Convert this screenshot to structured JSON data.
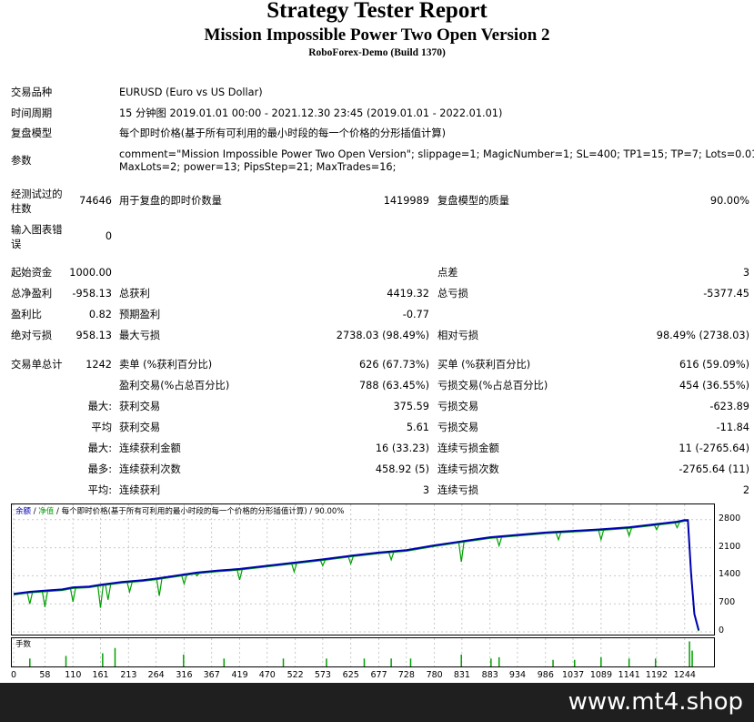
{
  "header": {
    "title": "Strategy Tester Report",
    "subtitle": "Mission Impossible Power Two Open Version 2",
    "server": "RoboForex-Demo (Build 1370)"
  },
  "info": {
    "symbol_label": "交易品种",
    "symbol_value": "EURUSD (Euro vs US Dollar)",
    "period_label": "时间周期",
    "period_value": "15 分钟图 2019.01.01 00:00 - 2021.12.30 23:45 (2019.01.01 - 2022.01.01)",
    "model_label": "复盘模型",
    "model_value": "每个即时价格(基于所有可利用的最小时段的每一个价格的分形插值计算)",
    "params_label": "参数",
    "params_line1": "comment=\"Mission Impossible Power Two Open Version\"; slippage=1; MagicNumber=1; SL=400; TP1=15; TP=7; Lots=0.01;",
    "params_line2": "MaxLots=2; power=13; PipsStep=21; MaxTrades=16;"
  },
  "bars": {
    "label_line1": "经测试过的",
    "label_line2": "柱数",
    "value": "74646",
    "ticks_label": "用于复盘的即时价数量",
    "ticks_value": "1419989",
    "quality_label": "复盘模型的质量",
    "quality_value": "90.00%",
    "errors_line1": "输入图表错",
    "errors_line2": "误",
    "errors_value": "0"
  },
  "stats": {
    "deposit_label": "起始资金",
    "deposit_value": "1000.00",
    "spread_label": "点差",
    "spread_value": "3",
    "net_label": "总净盈利",
    "net_value": "-958.13",
    "gross_profit_label": "总获利",
    "gross_profit_value": "4419.32",
    "gross_loss_label": "总亏损",
    "gross_loss_value": "-5377.45",
    "pf_label": "盈利比",
    "pf_value": "0.82",
    "payoff_label": "预期盈利",
    "payoff_value": "-0.77",
    "abs_dd_label": "绝对亏损",
    "abs_dd_value": "958.13",
    "max_dd_label": "最大亏损",
    "max_dd_value": "2738.03 (98.49%)",
    "rel_dd_label": "相对亏损",
    "rel_dd_value": "98.49% (2738.03)",
    "trades_label": "交易单总计",
    "trades_value": "1242",
    "short_label": "卖单 (%获利百分比)",
    "short_value": "626 (67.73%)",
    "long_label": "买单 (%获利百分比)",
    "long_value": "616 (59.09%)",
    "win_label": "盈利交易(%占总百分比)",
    "win_value": "788 (63.45%)",
    "loss_label": "亏损交易(%占总百分比)",
    "loss_value": "454 (36.55%)",
    "largest_prefix": "最大:",
    "largest_win_label": "获利交易",
    "largest_win_value": "375.59",
    "largest_loss_label": "亏损交易",
    "largest_loss_value": "-623.89",
    "average_prefix": "平均",
    "avg_win_label": "获利交易",
    "avg_win_value": "5.61",
    "avg_loss_label": "亏损交易",
    "avg_loss_value": "-11.84",
    "max_prefix": "最大:",
    "max_consec_win_label": "连续获利金额",
    "max_consec_win_value": "16 (33.23)",
    "max_consec_loss_label": "连续亏损金额",
    "max_consec_loss_value": "11 (-2765.64)",
    "maximal_prefix": "最多:",
    "maximal_consec_win_label": "连续获利次数",
    "maximal_consec_win_value": "458.92 (5)",
    "maximal_consec_loss_label": "连续亏损次数",
    "maximal_consec_loss_value": "-2765.64 (11)",
    "avg_consec_prefix": "平均:",
    "avg_consec_win_label": "连续获利",
    "avg_consec_win_value": "3",
    "avg_consec_loss_label": "连续亏损",
    "avg_consec_loss_value": "2"
  },
  "chart_data": {
    "type": "line",
    "legend_balance": "余额",
    "legend_equity": "净值",
    "legend_sep": "/",
    "legend_rest": "每个即时价格(基于所有可利用的最小时段的每一个价格的分形插值计算) / 90.00%",
    "volume_label": "手数",
    "colors": {
      "balance": "#0000b4",
      "equity": "#00a000",
      "grid": "#c8c8c8"
    },
    "ylim": [
      0,
      3000
    ],
    "y_ticks": [
      "2800",
      "2100",
      "1400",
      "700",
      "0"
    ],
    "x_ticks": [
      "0",
      "58",
      "110",
      "161",
      "213",
      "264",
      "316",
      "367",
      "419",
      "470",
      "522",
      "573",
      "625",
      "677",
      "728",
      "780",
      "831",
      "883",
      "934",
      "986",
      "1037",
      "1089",
      "1141",
      "1192",
      "1244"
    ],
    "xlim": [
      0,
      1295
    ],
    "balance": [
      [
        0,
        950
      ],
      [
        30,
        1000
      ],
      [
        60,
        1030
      ],
      [
        90,
        1060
      ],
      [
        110,
        1110
      ],
      [
        140,
        1130
      ],
      [
        161,
        1175
      ],
      [
        200,
        1245
      ],
      [
        240,
        1290
      ],
      [
        264,
        1330
      ],
      [
        300,
        1400
      ],
      [
        340,
        1480
      ],
      [
        380,
        1530
      ],
      [
        419,
        1570
      ],
      [
        470,
        1650
      ],
      [
        522,
        1730
      ],
      [
        573,
        1810
      ],
      [
        625,
        1900
      ],
      [
        677,
        1980
      ],
      [
        728,
        2040
      ],
      [
        780,
        2160
      ],
      [
        831,
        2260
      ],
      [
        883,
        2360
      ],
      [
        934,
        2420
      ],
      [
        986,
        2480
      ],
      [
        1037,
        2520
      ],
      [
        1089,
        2560
      ],
      [
        1141,
        2610
      ],
      [
        1192,
        2690
      ],
      [
        1230,
        2750
      ],
      [
        1244,
        2790
      ],
      [
        1250,
        2790
      ],
      [
        1256,
        1450
      ],
      [
        1262,
        450
      ],
      [
        1270,
        40
      ]
    ],
    "equity_dips": [
      [
        30,
        700
      ],
      [
        58,
        620
      ],
      [
        110,
        750
      ],
      [
        161,
        600
      ],
      [
        175,
        800
      ],
      [
        215,
        1000
      ],
      [
        270,
        900
      ],
      [
        316,
        1200
      ],
      [
        340,
        1400
      ],
      [
        419,
        1300
      ],
      [
        520,
        1500
      ],
      [
        573,
        1650
      ],
      [
        625,
        1700
      ],
      [
        700,
        1800
      ],
      [
        830,
        1750
      ],
      [
        900,
        2150
      ],
      [
        1010,
        2300
      ],
      [
        1089,
        2300
      ],
      [
        1141,
        2400
      ],
      [
        1192,
        2550
      ],
      [
        1230,
        2600
      ]
    ],
    "volume_spikes": [
      [
        30,
        0.3
      ],
      [
        97,
        0.4
      ],
      [
        165,
        0.5
      ],
      [
        188,
        0.7
      ],
      [
        315,
        0.45
      ],
      [
        390,
        0.3
      ],
      [
        500,
        0.3
      ],
      [
        580,
        0.3
      ],
      [
        650,
        0.3
      ],
      [
        700,
        0.3
      ],
      [
        736,
        0.3
      ],
      [
        830,
        0.45
      ],
      [
        885,
        0.3
      ],
      [
        900,
        0.35
      ],
      [
        1000,
        0.25
      ],
      [
        1040,
        0.25
      ],
      [
        1089,
        0.35
      ],
      [
        1141,
        0.3
      ],
      [
        1190,
        0.3
      ],
      [
        1253,
        0.95
      ],
      [
        1258,
        0.6
      ]
    ]
  },
  "footer": {
    "brand": "www.mt4.shop"
  }
}
